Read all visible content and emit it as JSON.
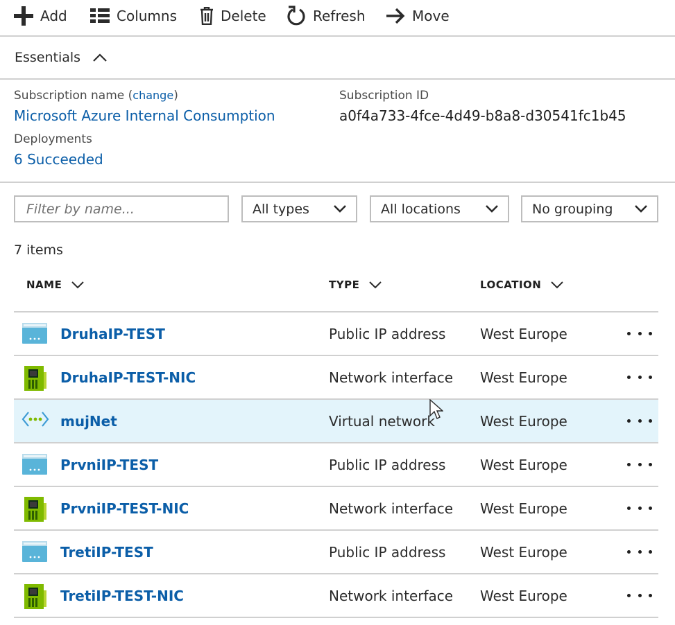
{
  "toolbar": {
    "add_label": "Add",
    "columns_label": "Columns",
    "delete_label": "Delete",
    "refresh_label": "Refresh",
    "move_label": "Move"
  },
  "essentials": {
    "title": "Essentials",
    "subscription_name_label": "Subscription name",
    "change_open": "(",
    "change_label": "change",
    "change_close": ")",
    "subscription_name_value": "Microsoft Azure Internal Consumption",
    "subscription_id_label": "Subscription ID",
    "subscription_id_value": "a0f4a733-4fce-4d49-b8a8-d30541fc1b45",
    "deployments_label": "Deployments",
    "deployments_value": "6 Succeeded"
  },
  "filters": {
    "name_placeholder": "Filter by name...",
    "types_value": "All types",
    "locations_value": "All locations",
    "grouping_value": "No grouping"
  },
  "item_count": "7 items",
  "table": {
    "columns": [
      "NAME",
      "TYPE",
      "LOCATION"
    ],
    "rows": [
      {
        "name": "DruhaIP-TEST",
        "type": "Public IP address",
        "location": "West Europe",
        "icon": "public-ip-icon"
      },
      {
        "name": "DruhaIP-TEST-NIC",
        "type": "Network interface",
        "location": "West Europe",
        "icon": "network-interface-icon"
      },
      {
        "name": "mujNet",
        "type": "Virtual network",
        "location": "West Europe",
        "icon": "virtual-network-icon"
      },
      {
        "name": "PrvniIP-TEST",
        "type": "Public IP address",
        "location": "West Europe",
        "icon": "public-ip-icon"
      },
      {
        "name": "PrvniIP-TEST-NIC",
        "type": "Network interface",
        "location": "West Europe",
        "icon": "network-interface-icon"
      },
      {
        "name": "TretiIP-TEST",
        "type": "Public IP address",
        "location": "West Europe",
        "icon": "public-ip-icon"
      },
      {
        "name": "TretiIP-TEST-NIC",
        "type": "Network interface",
        "location": "West Europe",
        "icon": "network-interface-icon"
      }
    ],
    "selected_row": 2
  },
  "colors": {
    "link": "#0b5ea8",
    "selected_row_bg": "#e3f4fb",
    "border": "#d0d0d0",
    "nic_green": "#7fba00",
    "ip_blue": "#59b4d9"
  }
}
